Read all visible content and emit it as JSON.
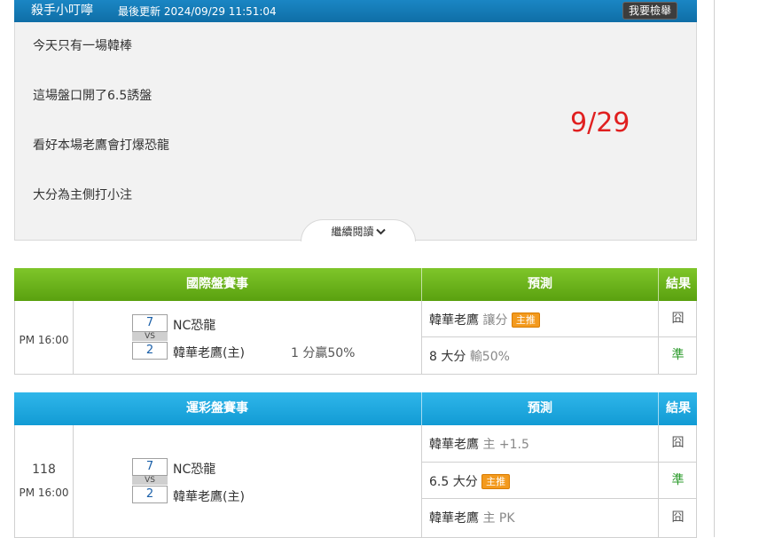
{
  "header": {
    "author": "殺手小叮嚀",
    "updated": "最後更新 2024/09/29 11:51:04",
    "report_button": "我要檢舉"
  },
  "article": {
    "lines": [
      "今天只有一場韓棒",
      "這場盤口開了6.5誘盤",
      "看好本場老鷹會打爆恐龍",
      "大分為主側打小注"
    ],
    "date_stamp": "9/29",
    "read_more": "繼續閱讀"
  },
  "international": {
    "headers": {
      "match": "國際盤賽事",
      "prediction": "預測",
      "result": "結果"
    },
    "time": "PM 16:00",
    "home_score": "7",
    "away_score": "2",
    "vs": "VS",
    "team1": "NC恐龍",
    "team2": "韓華老鷹(主)",
    "handicap": "1 分贏50%",
    "predictions": [
      {
        "main": "韓華老鷹",
        "note": "讓分",
        "badge": "主推",
        "result": "囧"
      },
      {
        "main": "8 大分",
        "note": "輸50%",
        "badge": "",
        "result": "準"
      }
    ]
  },
  "sports_lottery": {
    "headers": {
      "match": "運彩盤賽事",
      "prediction": "預測",
      "result": "結果"
    },
    "game_no": "118",
    "time": "PM 16:00",
    "home_score": "7",
    "away_score": "2",
    "vs": "VS",
    "team1": "NC恐龍",
    "team2": "韓華老鷹(主)",
    "predictions": [
      {
        "main": "韓華老鷹",
        "note": "主 +1.5",
        "badge": "",
        "result": "囧"
      },
      {
        "main": "6.5 大分",
        "note": "",
        "badge": "主推",
        "result": "準"
      },
      {
        "main": "韓華老鷹",
        "note": "主 PK",
        "badge": "",
        "result": "囧"
      }
    ]
  },
  "colors": {
    "header_blue": "#1a86c4",
    "green_head": "#6cb51c",
    "blue_head": "#1ea8df",
    "badge": "#f39a1e",
    "date_red": "#e02020",
    "ok_green": "#2a9a2a"
  }
}
